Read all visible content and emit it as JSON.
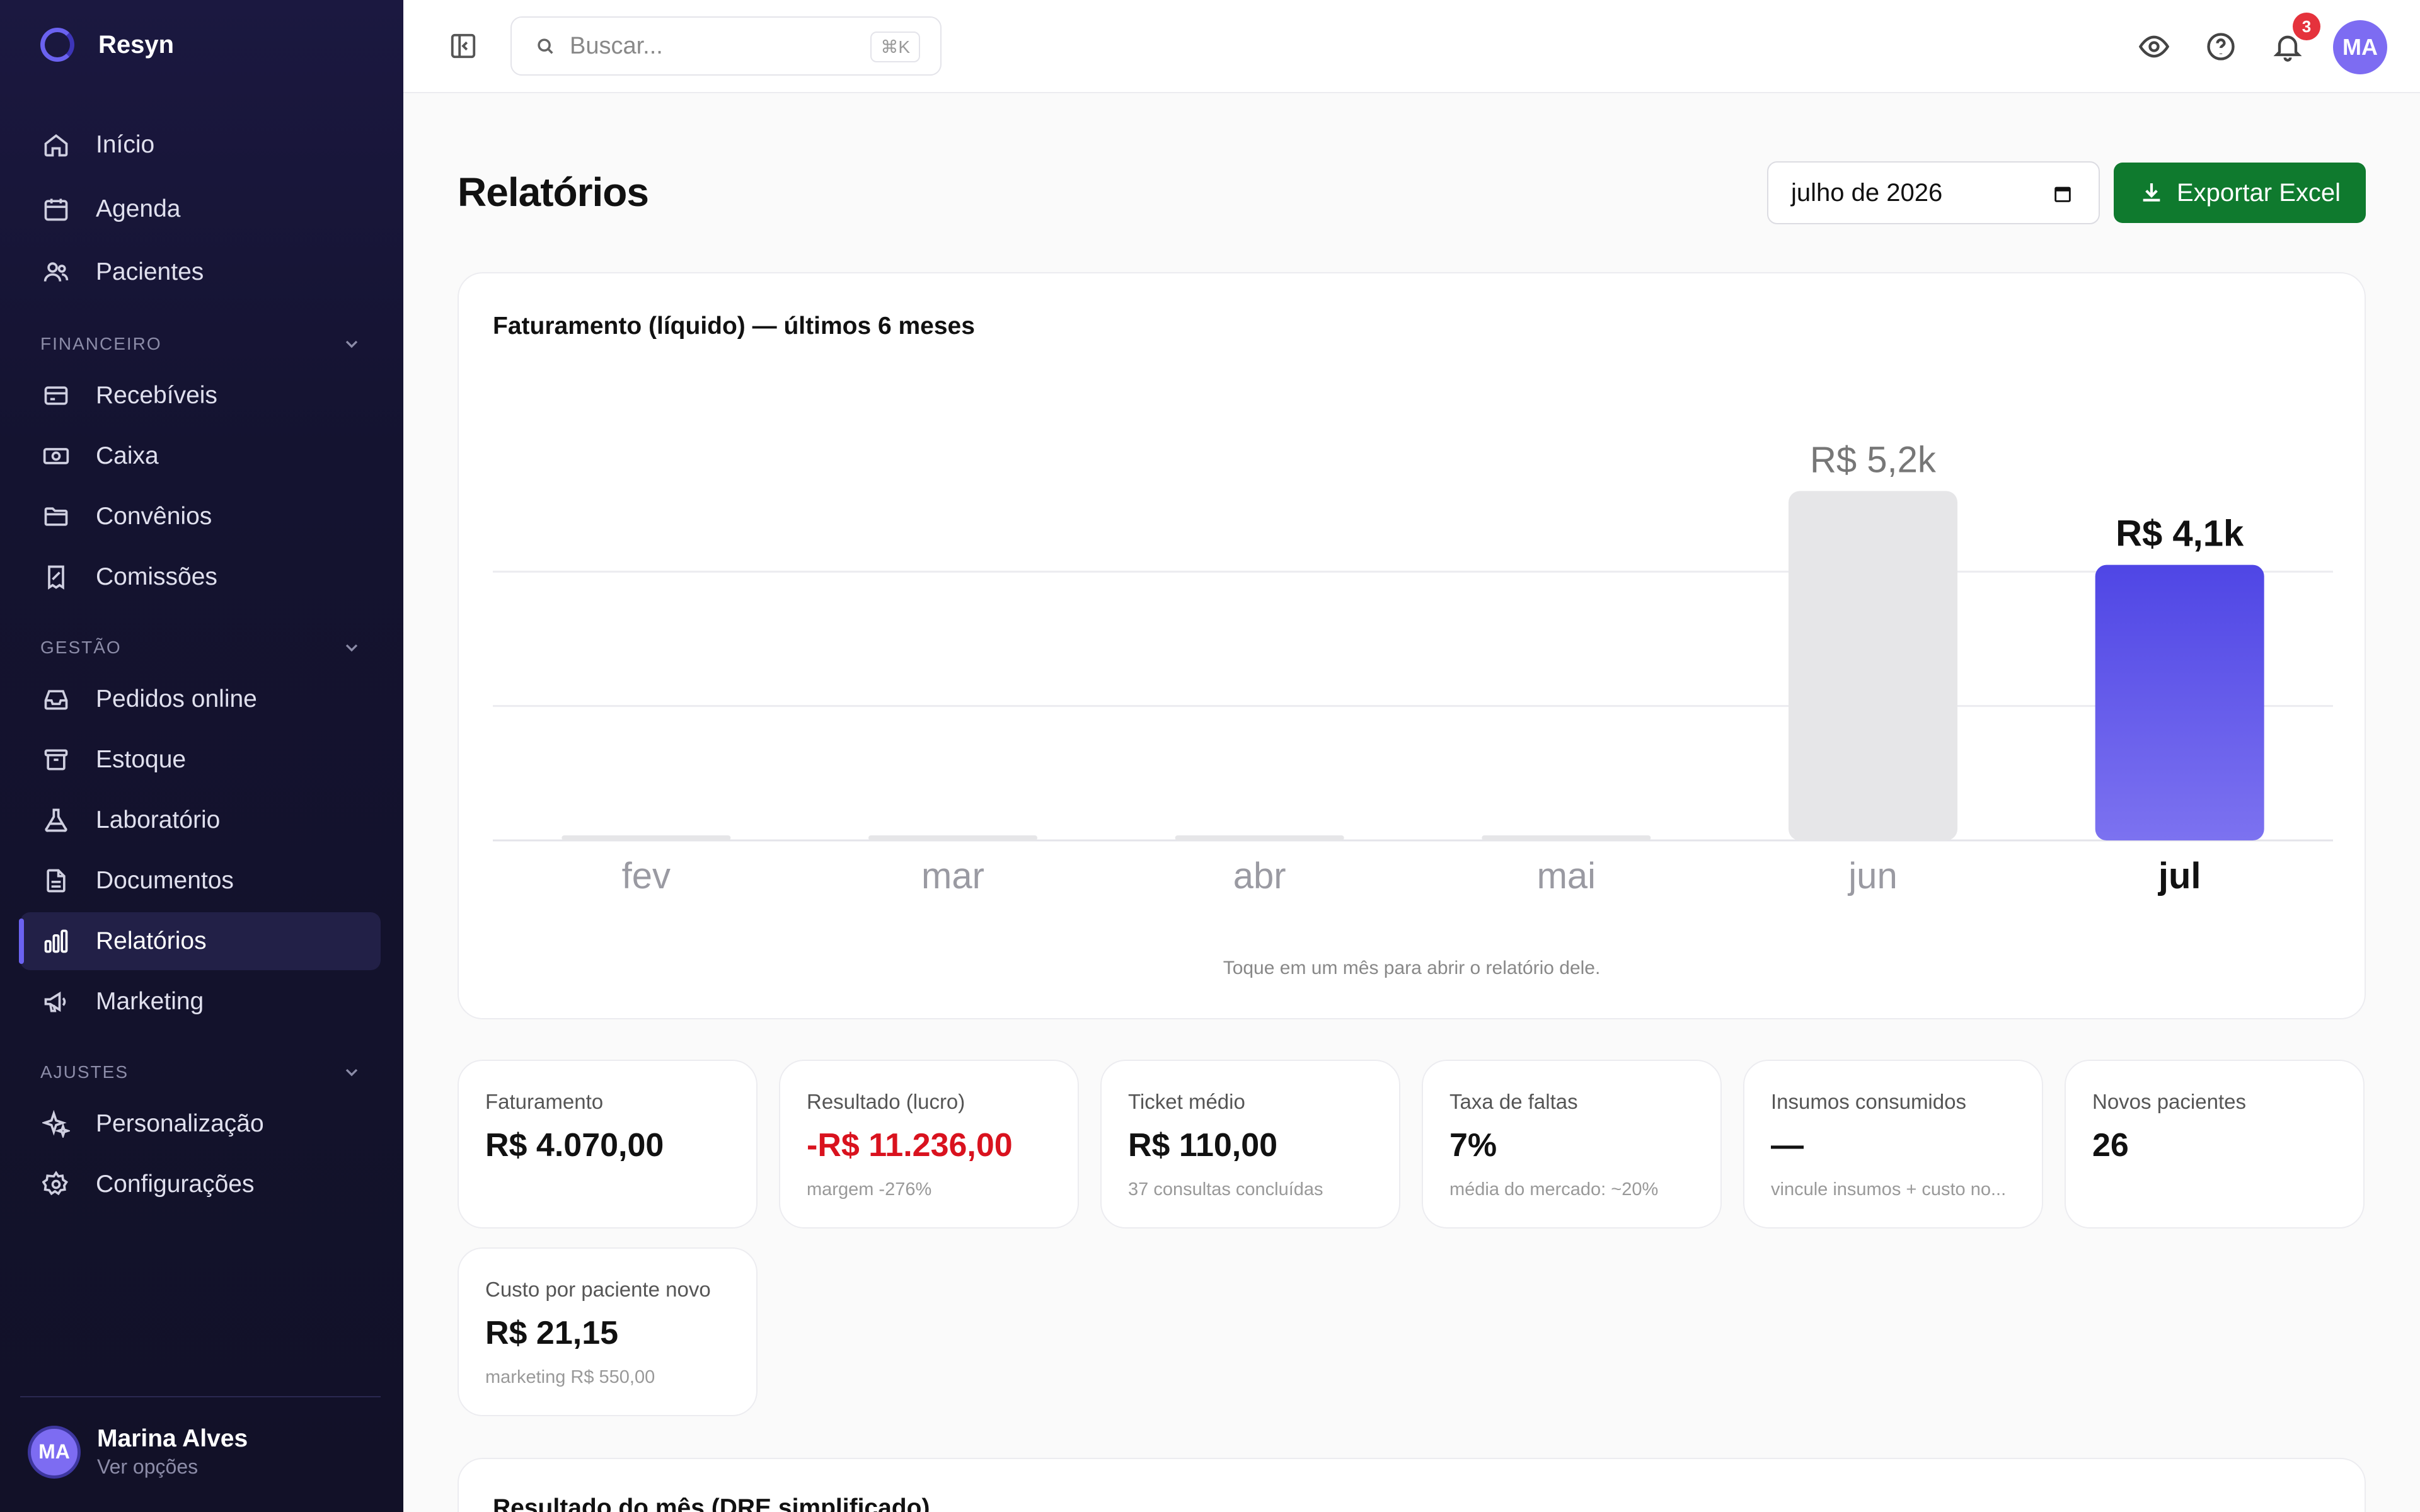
{
  "app": {
    "name": "Resyn"
  },
  "sidebar": {
    "items_top": [
      {
        "label": "Início",
        "icon": "home-icon"
      },
      {
        "label": "Agenda",
        "icon": "calendar-icon"
      },
      {
        "label": "Pacientes",
        "icon": "users-icon"
      }
    ],
    "sections": [
      {
        "title": "FINANCEIRO",
        "items": [
          {
            "label": "Recebíveis",
            "icon": "card-icon"
          },
          {
            "label": "Caixa",
            "icon": "cash-icon"
          },
          {
            "label": "Convênios",
            "icon": "folder-icon"
          },
          {
            "label": "Comissões",
            "icon": "receipt-icon"
          }
        ]
      },
      {
        "title": "GESTÃO",
        "items": [
          {
            "label": "Pedidos online",
            "icon": "inbox-icon"
          },
          {
            "label": "Estoque",
            "icon": "archive-icon"
          },
          {
            "label": "Laboratório",
            "icon": "flask-icon"
          },
          {
            "label": "Documentos",
            "icon": "document-icon"
          },
          {
            "label": "Relatórios",
            "icon": "bar-chart-icon",
            "active": true
          },
          {
            "label": "Marketing",
            "icon": "megaphone-icon"
          }
        ]
      },
      {
        "title": "AJUSTES",
        "items": [
          {
            "label": "Personalização",
            "icon": "sparkles-icon"
          },
          {
            "label": "Configurações",
            "icon": "gear-icon"
          }
        ]
      }
    ],
    "user": {
      "initials": "MA",
      "name": "Marina Alves",
      "sub": "Ver opções"
    }
  },
  "topbar": {
    "search_placeholder": "Buscar...",
    "shortcut": "⌘K",
    "notification_count": "3",
    "avatar_initials": "MA"
  },
  "main": {
    "title": "Relatórios",
    "month_value": "julho de 2026",
    "export_label": "Exportar Excel"
  },
  "chart_data": {
    "type": "bar",
    "title": "Faturamento (líquido) — últimos 6 meses",
    "categories": [
      "fev",
      "mar",
      "abr",
      "mai",
      "jun",
      "jul"
    ],
    "values": [
      0,
      0,
      0,
      0,
      5.2,
      4.1
    ],
    "value_labels": [
      "",
      "",
      "",
      "",
      "R$ 5,2k",
      "R$ 4,1k"
    ],
    "unit": "R$ mil",
    "highlight": "jul",
    "ylim": [
      0,
      6
    ],
    "grid": true,
    "colors": {
      "highlight": "#4f46e5",
      "muted": "#e6e6e8"
    },
    "hint": "Toque em um mês para abrir o relatório dele."
  },
  "stats": [
    {
      "label": "Faturamento",
      "value": "R$ 4.070,00",
      "sub": ""
    },
    {
      "label": "Resultado (lucro)",
      "value": "-R$ 11.236,00",
      "sub": "margem -276%",
      "negative": true
    },
    {
      "label": "Ticket médio",
      "value": "R$ 110,00",
      "sub": "37 consultas concluídas"
    },
    {
      "label": "Taxa de faltas",
      "value": "7%",
      "sub": "média do mercado: ~20%"
    },
    {
      "label": "Insumos consumidos",
      "value": "—",
      "sub": "vincule insumos + custo no..."
    },
    {
      "label": "Novos pacientes",
      "value": "26",
      "sub": ""
    },
    {
      "label": "Custo por paciente novo",
      "value": "R$ 21,15",
      "sub": "marketing R$ 550,00"
    }
  ],
  "dre": {
    "title": "Resultado do mês (DRE simplificado)"
  }
}
